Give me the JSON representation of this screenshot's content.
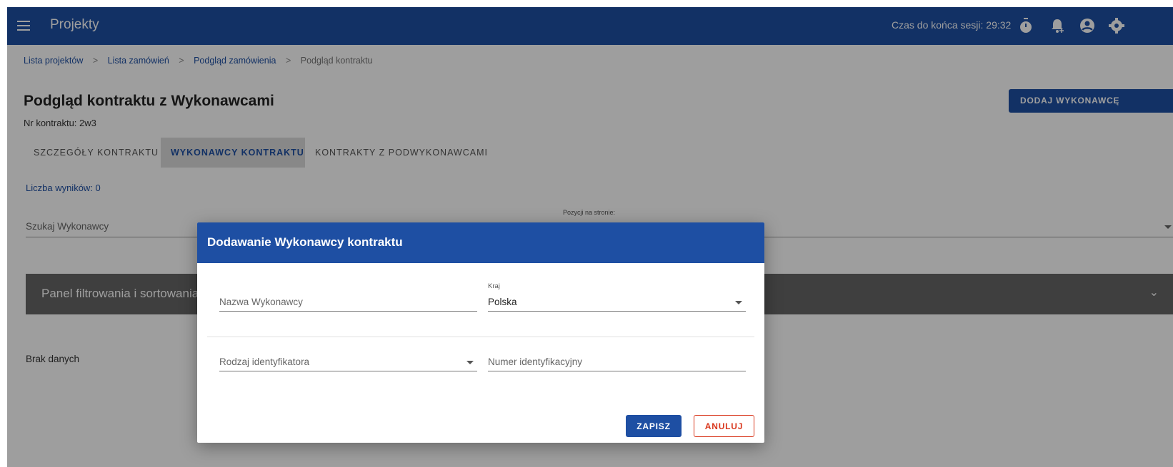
{
  "topbar": {
    "app_title": "Projekty",
    "session_text": "Czas do końca sesji: 29:32",
    "icons": [
      "menu-icon",
      "stopwatch-icon",
      "bell-icon",
      "account-icon",
      "settings-icon"
    ]
  },
  "breadcrumb": [
    "Lista projektów",
    "Lista zamówień",
    "Podgląd zamówienia",
    "Podgląd kontraktu"
  ],
  "breadcrumb_separator": ">",
  "page": {
    "title": "Podgląd kontraktu z Wykonawcami",
    "contract_nr": "Nr kontraktu: 2w3",
    "add_button": "DODAJ WYKONAWCĘ"
  },
  "tabs": [
    {
      "label": "SZCZEGÓŁY KONTRAKTU",
      "active": false
    },
    {
      "label": "WYKONAWCY KONTRAKTU",
      "active": true
    },
    {
      "label": "KONTRAKTY Z PODWYKONAWCAMI",
      "active": false
    }
  ],
  "results_count": "Liczba wyników: 0",
  "per_page_label": "Pozycji na stronie:",
  "search": {
    "placeholder": "Szukaj Wykonawcy"
  },
  "filter_panel": {
    "label": "Panel filtrowania i sortowania"
  },
  "no_data": "Brak danych",
  "dialog": {
    "title": "Dodawanie Wykonawcy kontraktu",
    "name_placeholder": "Nazwa Wykonawcy",
    "country_label": "Kraj",
    "country_value": "Polska",
    "id_type_placeholder": "Rodzaj identyfikatora",
    "id_number_placeholder": "Numer identyfikacyjny",
    "save": "ZAPISZ",
    "cancel": "ANULUJ"
  },
  "colors": {
    "primary": "#1e4fa3",
    "danger": "#d9381e",
    "filter_panel": "#666666"
  }
}
